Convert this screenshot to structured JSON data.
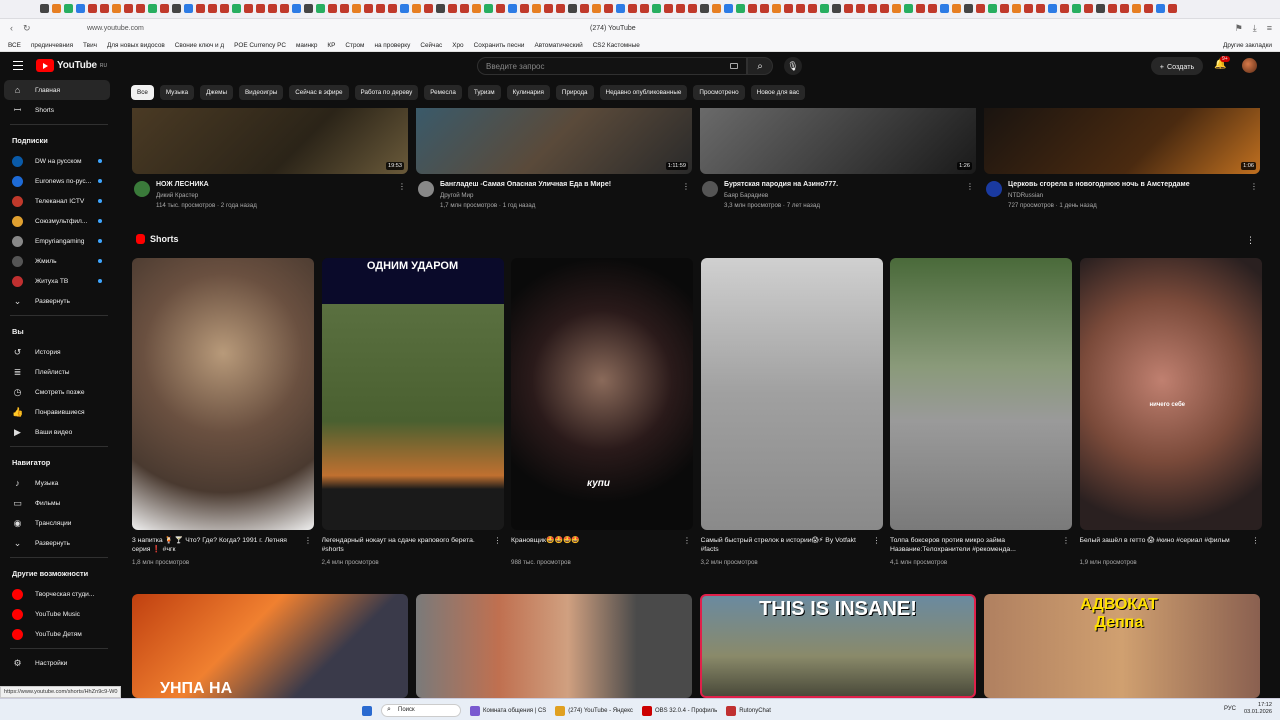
{
  "browser": {
    "url": "www.youtube.com",
    "window_title": "(274) YouTube",
    "bookmarks": [
      "ВСЕ",
      "прединчевния",
      "Твич",
      "Для новых видосов",
      "Своние ключ и д",
      "POE Currency PC",
      "маинкр",
      "КР",
      "Стром",
      "на проверку",
      "Сейчас",
      "Хро",
      "Сохранить песни",
      "Автоматический",
      "CS2 Кастомные"
    ],
    "other_bookmarks": "Другие закладки"
  },
  "masthead": {
    "logo": "YouTube",
    "logo_region": "RU",
    "search_placeholder": "Введите запрос",
    "create_label": "Создать",
    "notifications_badge": "9+"
  },
  "sidebar": {
    "main": [
      {
        "label": "Главная",
        "icon": "home-icon",
        "active": true
      },
      {
        "label": "Shorts",
        "icon": "shorts-icon"
      }
    ],
    "subscriptions_title": "Подписки",
    "subscriptions": [
      {
        "label": "DW на русском",
        "color": "#0a5aa8"
      },
      {
        "label": "Euronews по-рус...",
        "color": "#1e6bd6"
      },
      {
        "label": "Телеканал ICTV",
        "color": "#c0392b"
      },
      {
        "label": "Союзмультфил...",
        "color": "#e0a030"
      },
      {
        "label": "Empyriangaming",
        "color": "#888888"
      },
      {
        "label": "Жмиль",
        "color": "#555555"
      },
      {
        "label": "Житуха ТВ",
        "color": "#c03030"
      }
    ],
    "expand_label": "Развернуть",
    "you_title": "Вы",
    "you": [
      {
        "label": "История",
        "icon": "history-icon"
      },
      {
        "label": "Плейлисты",
        "icon": "playlist-icon"
      },
      {
        "label": "Смотреть позже",
        "icon": "watch-later-icon"
      },
      {
        "label": "Понравившиеся",
        "icon": "like-icon"
      },
      {
        "label": "Ваши видео",
        "icon": "your-videos-icon"
      }
    ],
    "navigator_title": "Навигатор",
    "navigator": [
      {
        "label": "Музыка",
        "icon": "music-icon"
      },
      {
        "label": "Фильмы",
        "icon": "film-icon"
      },
      {
        "label": "Трансляции",
        "icon": "live-icon"
      },
      {
        "label": "Развернуть",
        "icon": "chevron-down-icon"
      }
    ],
    "more_title": "Другие возможности",
    "more": [
      {
        "label": "Творческая студи...",
        "color": "#ff0000"
      },
      {
        "label": "YouTube Music",
        "color": "#ff0000"
      },
      {
        "label": "YouTube Детям",
        "color": "#ff0000"
      }
    ],
    "settings_label": "Настройки"
  },
  "chips": [
    "Все",
    "Музыка",
    "Джемы",
    "Видеоигры",
    "Сейчас в эфире",
    "Работа по дереву",
    "Ремесла",
    "Туризм",
    "Кулинария",
    "Природа",
    "Недавно опубликованные",
    "Просмотрено",
    "Новое для вас"
  ],
  "videos_row1": [
    {
      "title": "НОЖ ЛЕСНИКА",
      "channel": "Дикий Крастер",
      "stats": "114 тыс. просмотров · 2 года назад",
      "duration": "19:53",
      "bg": "linear-gradient(135deg,#4a3a24,#2b2418 60%,#6a5a3a)"
    },
    {
      "title": "Бангладеш -Самая Опасная Уличная Еда в Мире!",
      "channel": "Другой Мир",
      "stats": "1,7 млн просмотров · 1 год назад",
      "duration": "1:11:59",
      "bg": "linear-gradient(135deg,#3a5a6a,#5a4a3a 50%,#2a2a2a)"
    },
    {
      "title": "Бурятская пародия на Азино777.",
      "channel": "Баяр Барадиев",
      "stats": "3,3 млн просмотров · 7 лет назад",
      "duration": "1:26",
      "bg": "linear-gradient(135deg,#6a6a6a,#3a3a3a 60%,#1a1a1a)"
    },
    {
      "title": "Церковь сгорела в новогоднюю ночь в Амстердаме",
      "channel": "NTDRussian",
      "stats": "727 просмотров · 1 день назад",
      "duration": "1:06",
      "bg": "linear-gradient(135deg,#1a1410,#4a2a10 60%,#c07020)"
    }
  ],
  "shorts_title": "Shorts",
  "shorts": [
    {
      "title": "3 напитка 🍹 🍸 Что? Где? Когда? 1991 г. Летняя серия ❗ #чгк",
      "views": "1,8 млн просмотров",
      "bg": "radial-gradient(circle at 50% 35%,#b89a7a,#6a5040 40%,#4a3a30 70%,#f0f0f0 100%)",
      "overlay": ""
    },
    {
      "title": "Легендарный нокаут на сдаче крапового берета. #shorts",
      "views": "2,4 млн просмотров",
      "bg": "linear-gradient(180deg,#0a0a2a 0%,#0a0a2a 17%,#5a7040 17%,#4a6030 60%,#c07030 80%,#1a1a1a 85%)",
      "overlay": "ОДНИМ УДАРОМ"
    },
    {
      "title": "Крановщик🤩🤩🤩🤩",
      "views": "988 тыс. просмотров",
      "bg": "radial-gradient(circle at 50% 45%,#8a6a5a,#2a1a1a 40%,#0a0a0a 70%)",
      "overlay": "купи"
    },
    {
      "title": "Самый быстрый стрелок в истории😱⚡ By Votfakt #facts",
      "views": "3,2 млн просмотров",
      "bg": "linear-gradient(180deg,#d0d0d0,#a0a0a0 50%,#8a8a8a)",
      "overlay": ""
    },
    {
      "title": "Толпа боксеров против микро займа Название:Телохранители #рекоменда...",
      "views": "4,1 млн просмотров",
      "bg": "linear-gradient(180deg,#4a6a3a 0%,#8a9a7a 40%,#9a9a9a 60%,#7a7a7a)",
      "overlay": ""
    },
    {
      "title": "Белый зашёл в гетто 😱 #кино #сериал #фильм",
      "views": "1,9 млн просмотров",
      "bg": "radial-gradient(circle at 45% 45%,#c08070,#7a4a3a 45%,#2a2020 80%)",
      "overlay": "ничего себе"
    }
  ],
  "videos_row2": [
    {
      "bg": "linear-gradient(135deg,#c04010,#f08030 40%,#3a3a4a 70%)",
      "overlay": "УНПА НА"
    },
    {
      "bg": "linear-gradient(90deg,#7a7a7a,#c07050 30%,#d0a080 55%,#4a4a4a 80%)",
      "overlay": ""
    },
    {
      "bg": "linear-gradient(180deg,#6a8aa0,#8a8a6a 60%,#4a4a3a)",
      "overlay": "THIS IS INSANE!"
    },
    {
      "bg": "linear-gradient(90deg,#b08060,#d0a070 50%,#8a6050)",
      "overlay": "АДВОКАТ Деппа"
    }
  ],
  "statusbar": {
    "url": "https://www.youtube.com/shorts/HhZn9c9-W0"
  },
  "taskbar": {
    "search": "Поиск",
    "apps": [
      "Комната общения | CS",
      "(274) YouTube - Яндекс",
      "OBS 32.0.4 - Профиль",
      "RutonyChat"
    ],
    "lang": "РУС",
    "time": "17:12",
    "date": "03.01.2026"
  }
}
